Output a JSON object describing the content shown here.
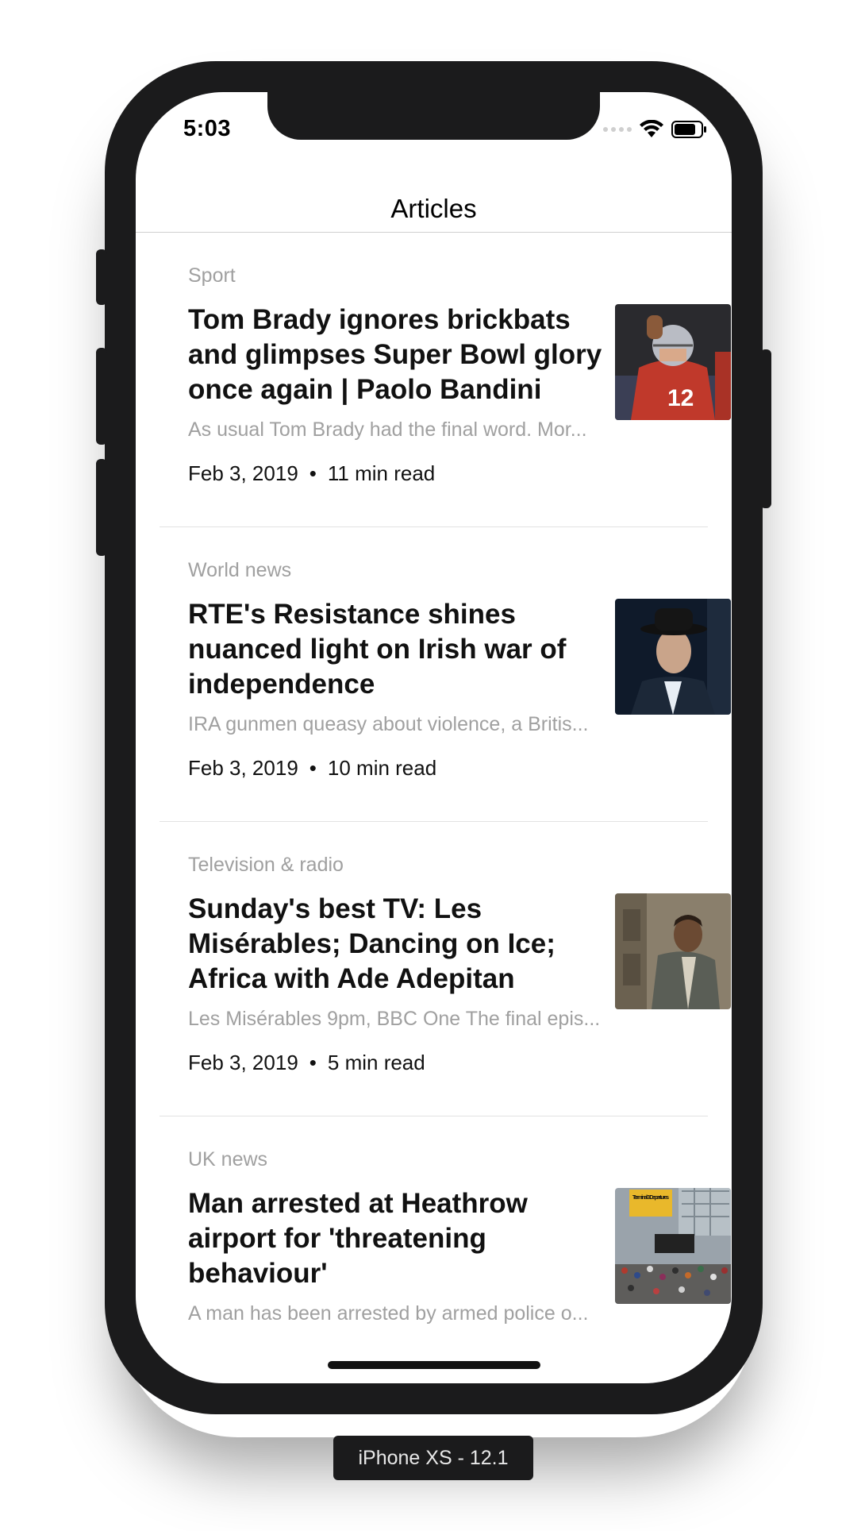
{
  "status_bar": {
    "time": "5:03"
  },
  "nav": {
    "title": "Articles"
  },
  "articles": [
    {
      "category": "Sport",
      "headline": "Tom Brady ignores brickbats and glimpses Super Bowl glory once again | Paolo Bandini",
      "summary": "As usual Tom Brady had the final word. Mor...",
      "date": "Feb 3, 2019",
      "read_time": "11 min read",
      "thumbnail": "football-player-photo"
    },
    {
      "category": "World news",
      "headline": "RTE's Resistance shines nuanced light on Irish war of independence",
      "summary": "IRA gunmen queasy about violence, a Britis...",
      "date": "Feb 3, 2019",
      "read_time": "10 min read",
      "thumbnail": "man-in-hat-photo"
    },
    {
      "category": "Television & radio",
      "headline": "Sunday's best TV: Les Misérables; Dancing on Ice; Africa with Ade Adepitan",
      "summary": "Les Misérables 9pm, BBC One The final epis...",
      "date": "Feb 3, 2019",
      "read_time": "5 min read",
      "thumbnail": "period-drama-actor-photo"
    },
    {
      "category": "UK news",
      "headline": "Man arrested at Heathrow airport for 'threatening behaviour'",
      "summary": "A man has been arrested by armed police o...",
      "date": "",
      "read_time": "",
      "thumbnail": "airport-terminal-photo"
    }
  ],
  "thumb_text": {
    "terminal_sign": "Terminal 3 Departures"
  },
  "meta_separator": "•",
  "device_label": "iPhone XS - 12.1",
  "colors": {
    "frame": "#1b1b1c",
    "category": "#a0a0a0",
    "headline": "#111111",
    "divider": "#e2e2e2"
  }
}
